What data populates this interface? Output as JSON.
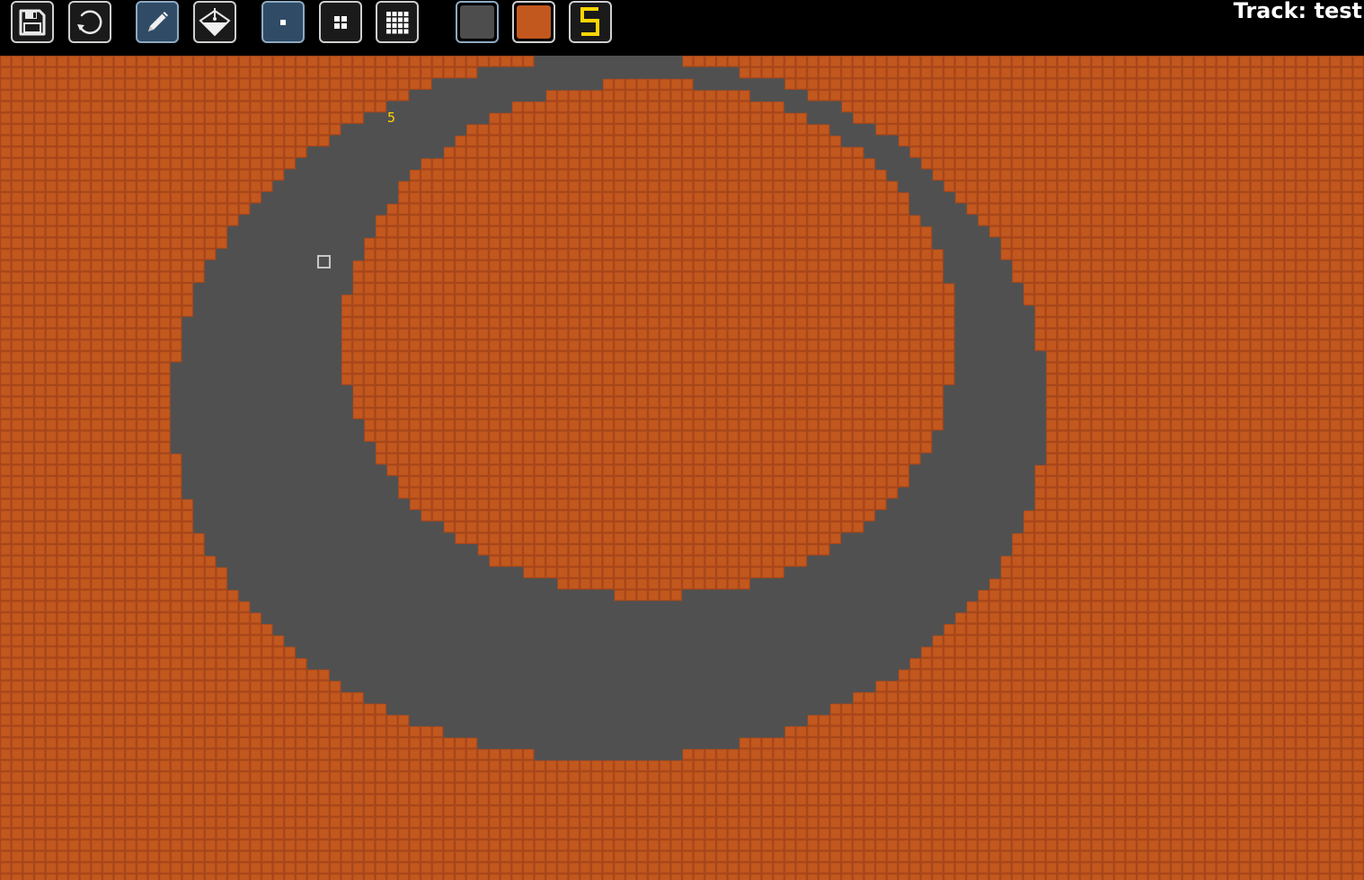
{
  "app": {
    "track_label": "Track: test"
  },
  "toolbar": {
    "file_tools": [
      {
        "name": "save-button",
        "icon": "floppy-disk-icon"
      },
      {
        "name": "reset-button",
        "icon": "circular-arrow-icon"
      }
    ],
    "draw_tools": [
      {
        "name": "pencil-tool-button",
        "icon": "pencil-icon",
        "selected": true
      },
      {
        "name": "fill-tool-button",
        "icon": "paint-bucket-icon",
        "selected": false
      }
    ],
    "brush_sizes": [
      {
        "name": "brush-size-small-button",
        "icon": "single-dot-icon",
        "selected": true
      },
      {
        "name": "brush-size-medium-button",
        "icon": "four-dots-icon",
        "selected": false
      },
      {
        "name": "brush-size-large-button",
        "icon": "dot-grid-icon",
        "selected": false
      }
    ],
    "tile_palette": [
      {
        "name": "tile-asphalt-swatch",
        "tile": "asphalt",
        "color": "#505050",
        "selected": true
      },
      {
        "name": "tile-dirt-swatch",
        "tile": "dirt",
        "color": "#c2581e",
        "selected": false
      },
      {
        "name": "tile-start-marker-swatch",
        "tile": "start",
        "glyph": "5",
        "glyph_color": "#ffd500",
        "selected": false
      }
    ]
  },
  "canvas": {
    "colors": {
      "dirt": "#c2581e",
      "dirt_grid": "#a8461a",
      "asphalt": "#505050",
      "background": "#000000"
    },
    "tile_size_px": 12.65,
    "start_marker": {
      "label": "5",
      "color": "#ffd500"
    },
    "cursor": {
      "icon": "square-cursor-icon"
    }
  }
}
